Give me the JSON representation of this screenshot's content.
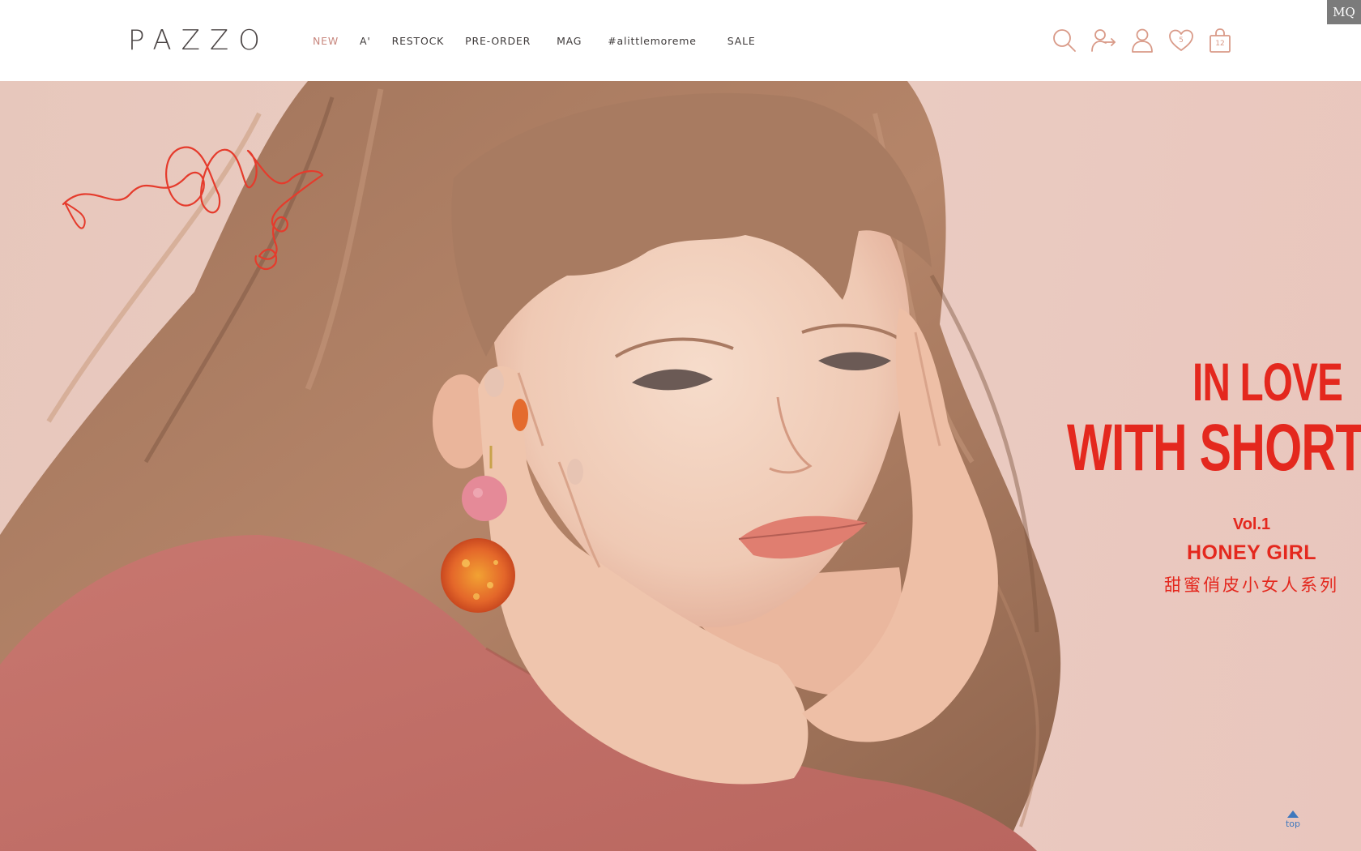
{
  "header": {
    "logo": "PAZZO",
    "nav": [
      {
        "label": "NEW",
        "active": true
      },
      {
        "label": "A'",
        "active": false
      },
      {
        "label": "RESTOCK",
        "active": false
      },
      {
        "label": "PRE-ORDER",
        "active": false
      },
      {
        "label": "MAG",
        "active": false
      },
      {
        "label": "#alittlemoreme",
        "active": false
      },
      {
        "label": "SALE",
        "active": false
      }
    ],
    "icons": {
      "search": "search-icon",
      "login": "login-icon",
      "account": "user-icon",
      "wishlist": "heart-icon",
      "bag": "shopping-bag-icon"
    },
    "wishlist_count": "5",
    "bag_count": "12"
  },
  "badge": "MQ",
  "hero": {
    "headline_line1": "IN LOVE",
    "headline_line2": "WITH SHORTCA",
    "volume": "Vol.1",
    "collection": "HONEY GIRL",
    "collection_zh": "甜蜜俏皮小女人系列"
  },
  "top_button": {
    "label": "top"
  },
  "colors": {
    "accent_nav": "#c8877e",
    "icon_stroke": "#d99a88",
    "headline_red": "#e4281e",
    "top_blue": "#3f78bd",
    "hero_bg": "#ebcdc3"
  }
}
